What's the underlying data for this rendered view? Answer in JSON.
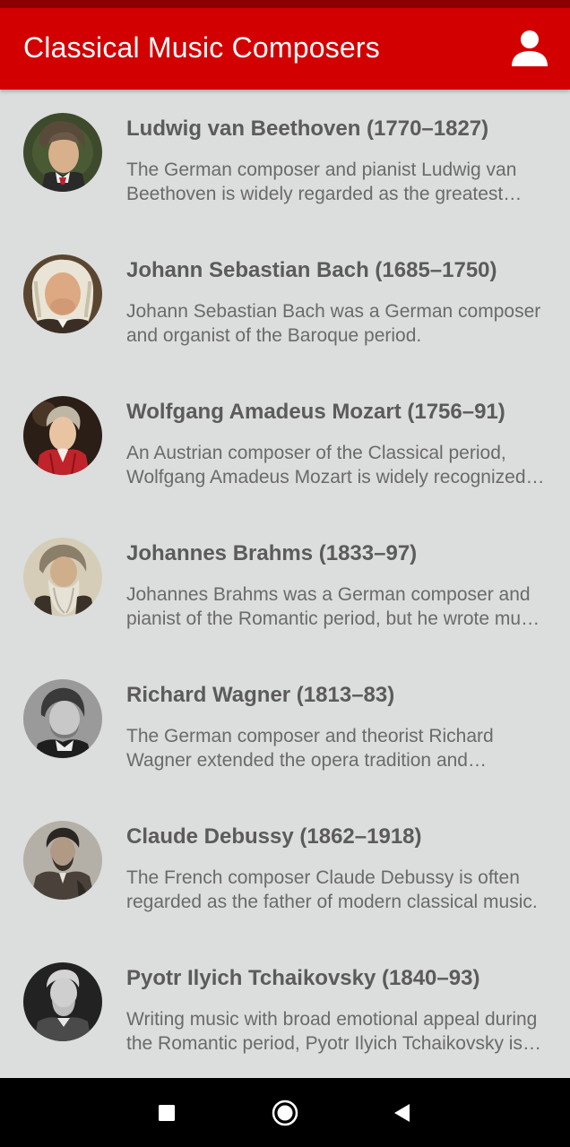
{
  "app_bar": {
    "title": "Classical Music Composers",
    "profile_icon": "person-icon",
    "color": "#d30000"
  },
  "composers": [
    {
      "name": "Ludwig van Beethoven (1770–1827)",
      "description": "The German composer and pianist Ludwig van Beethoven is widely regarded as the greatest composer who ever lived.",
      "avatar_icon": "beethoven-portrait"
    },
    {
      "name": "Johann Sebastian Bach (1685–1750)",
      "description": "Johann Sebastian Bach was a German composer and organist of the Baroque period.",
      "avatar_icon": "bach-portrait"
    },
    {
      "name": "Wolfgang Amadeus Mozart (1756–91)",
      "description": "An Austrian composer of the Classical period, Wolfgang Amadeus Mozart is widely recognized as one of the greatest composers.",
      "avatar_icon": "mozart-portrait"
    },
    {
      "name": "Johannes Brahms (1833–97)",
      "description": "Johannes Brahms was a German composer and pianist of the Romantic period, but he wrote music in a Classical style.",
      "avatar_icon": "brahms-portrait"
    },
    {
      "name": "Richard Wagner (1813–83)",
      "description": "The German composer and theorist Richard Wagner extended the opera tradition and revolutionized it.",
      "avatar_icon": "wagner-portrait"
    },
    {
      "name": "Claude Debussy (1862–1918)",
      "description": "The French composer Claude Debussy is often regarded as the father of modern classical music.",
      "avatar_icon": "debussy-portrait"
    },
    {
      "name": "Pyotr Ilyich Tchaikovsky (1840–93)",
      "description": "Writing music with broad emotional appeal during the Romantic period, Pyotr Ilyich Tchaikovsky is one of the most popular composers.",
      "avatar_icon": "tchaikovsky-portrait"
    }
  ],
  "nav_bar": {
    "recents_icon": "square-recents-icon",
    "home_icon": "circle-home-icon",
    "back_icon": "triangle-back-icon"
  }
}
